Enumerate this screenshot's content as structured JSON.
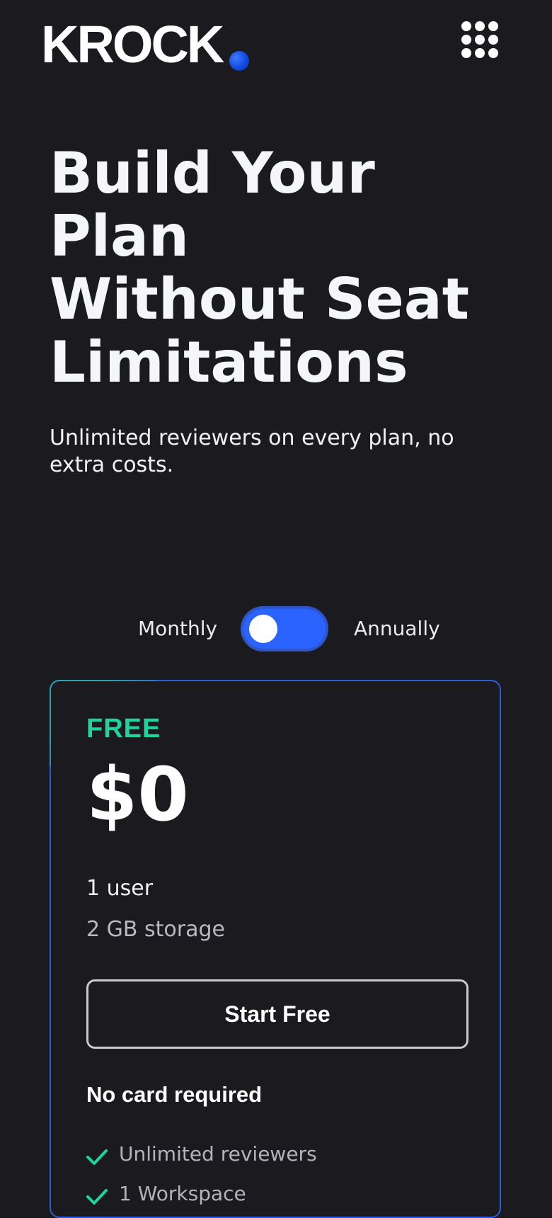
{
  "header": {
    "logo_text": "KROCK",
    "menu_icon": "grid-dots-icon"
  },
  "hero": {
    "title_lines": [
      "Build Your",
      "Plan",
      "Without Seat",
      "Limitations"
    ],
    "subtitle": "Unlimited reviewers on every plan, no extra costs."
  },
  "billing": {
    "monthly_label": "Monthly",
    "annually_label": "Annually",
    "annual_selected": true
  },
  "plan": {
    "name": "FREE",
    "price": "$0",
    "users": "1 user",
    "storage": "2 GB storage",
    "cta_label": "Start Free",
    "note": "No card required",
    "features": [
      {
        "label": "Unlimited reviewers",
        "icon": "check-icon"
      },
      {
        "label": "1 Workspace",
        "icon": "check-icon"
      }
    ]
  },
  "colors": {
    "background": "#1b1a1f",
    "accent_blue": "#2a63ff",
    "accent_green": "#1fd39a",
    "card_border": "#2e5bdc"
  }
}
